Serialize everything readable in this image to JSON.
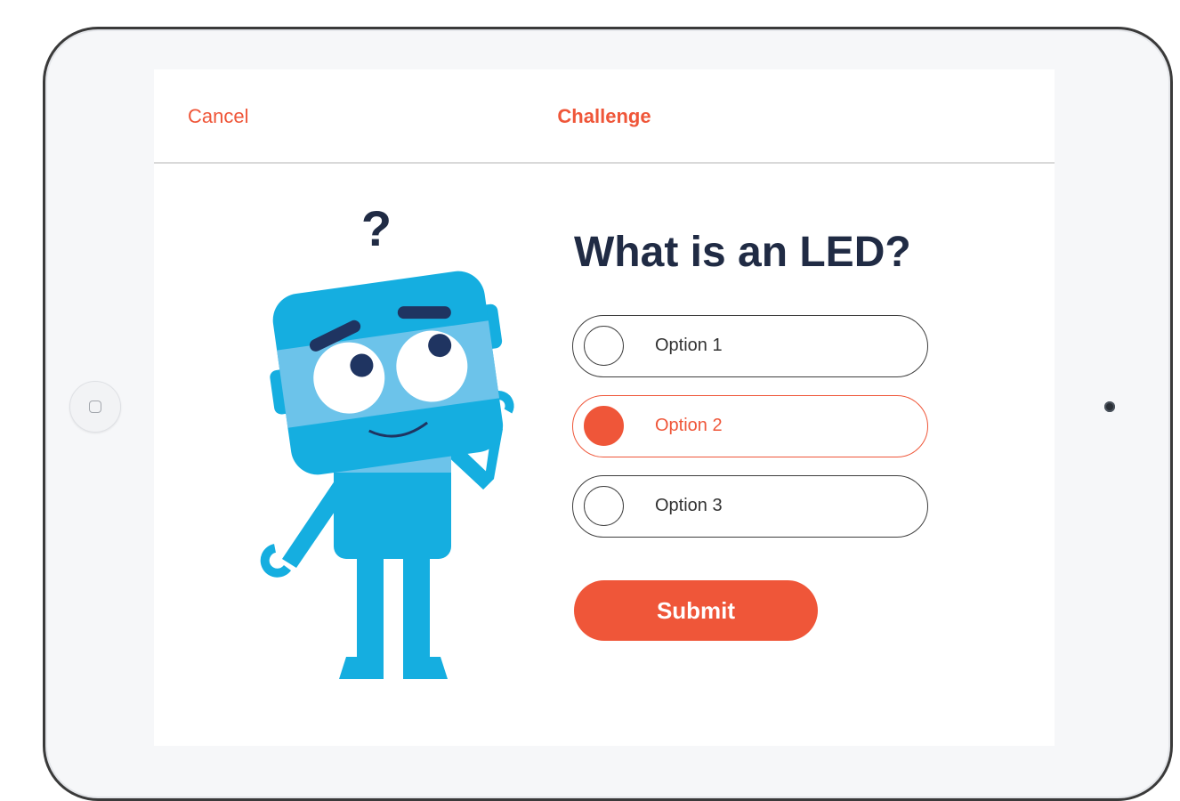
{
  "device": {
    "home_button_icon": "home-square-icon",
    "camera_icon": "front-camera-icon"
  },
  "nav": {
    "cancel_label": "Cancel",
    "title": "Challenge"
  },
  "question": {
    "text": "What is an LED?",
    "illustration_icon": "confused-robot-icon",
    "badge": "?"
  },
  "options": [
    {
      "label": "Option 1",
      "selected": false
    },
    {
      "label": "Option 2",
      "selected": true
    },
    {
      "label": "Option 3",
      "selected": false
    }
  ],
  "submit_label": "Submit",
  "colors": {
    "accent": "#ef5639",
    "heading": "#202b44",
    "robot_blue": "#15aee0",
    "robot_light_blue": "#6cc3ea",
    "robot_dark": "#1f3461"
  }
}
